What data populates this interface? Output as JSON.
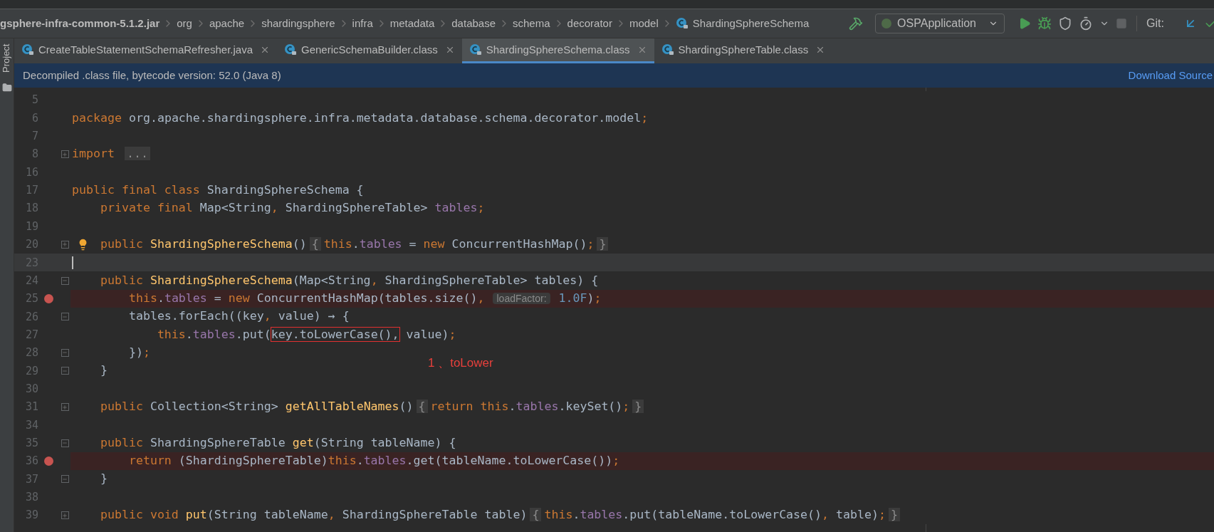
{
  "breadcrumbs": [
    {
      "label": "gsphere-infra-common-5.1.2.jar",
      "kind": "jar"
    },
    {
      "label": "org",
      "kind": "package"
    },
    {
      "label": "apache",
      "kind": "package"
    },
    {
      "label": "shardingsphere",
      "kind": "package"
    },
    {
      "label": "infra",
      "kind": "package"
    },
    {
      "label": "metadata",
      "kind": "package"
    },
    {
      "label": "database",
      "kind": "package"
    },
    {
      "label": "schema",
      "kind": "package"
    },
    {
      "label": "decorator",
      "kind": "package"
    },
    {
      "label": "model",
      "kind": "package"
    },
    {
      "label": "ShardingSphereSchema",
      "kind": "class"
    }
  ],
  "toolbar": {
    "run_config": "OSPApplication",
    "git_label": "Git:"
  },
  "side_tool": "Project",
  "tabs": [
    {
      "label": "CreateTableStatementSchemaRefresher.java",
      "selected": false
    },
    {
      "label": "GenericSchemaBuilder.class",
      "selected": false
    },
    {
      "label": "ShardingSphereSchema.class",
      "selected": true
    },
    {
      "label": "ShardingSphereTable.class",
      "selected": false
    }
  ],
  "banner": {
    "text": "Decompiled .class file, bytecode version: 52.0 (Java 8)",
    "link": "Download Source"
  },
  "lines": [
    {
      "number": "5",
      "breakpoint": false,
      "current": false
    },
    {
      "number": "6",
      "breakpoint": false,
      "current": false,
      "segments": [
        {
          "kind": "keyword",
          "text": "package "
        },
        {
          "kind": "plain",
          "text": "org.apache.shardingsphere.infra.metadata.database.schema.decorator.model"
        },
        {
          "kind": "keyword",
          "text": ";"
        }
      ]
    },
    {
      "number": "7",
      "breakpoint": false,
      "current": false
    },
    {
      "number": "8",
      "breakpoint": false,
      "current": false,
      "folded": true,
      "segments": [
        {
          "kind": "keyword",
          "text": "import "
        },
        {
          "kind": "folded",
          "text": "..."
        }
      ]
    },
    {
      "number": "16",
      "breakpoint": false,
      "current": false
    },
    {
      "number": "17",
      "breakpoint": false,
      "current": false,
      "segments": [
        {
          "kind": "keyword",
          "text": "public final class "
        },
        {
          "kind": "plain",
          "text": "ShardingSphereSchema {"
        }
      ]
    },
    {
      "number": "18",
      "breakpoint": false,
      "current": false,
      "segments": [
        {
          "kind": "keyword",
          "text": "    private final "
        },
        {
          "kind": "plain",
          "text": "Map<String"
        },
        {
          "kind": "keyword",
          "text": ", "
        },
        {
          "kind": "plain",
          "text": "ShardingSphereTable> "
        },
        {
          "kind": "field",
          "text": "tables"
        },
        {
          "kind": "keyword",
          "text": ";"
        }
      ]
    },
    {
      "number": "19",
      "breakpoint": false,
      "current": false
    },
    {
      "number": "20",
      "breakpoint": false,
      "current": false,
      "bulb": true,
      "folded": true,
      "segments": [
        {
          "kind": "keyword",
          "text": "    public "
        },
        {
          "kind": "method",
          "text": "ShardingSphereSchema"
        },
        {
          "kind": "plain",
          "text": "()"
        },
        {
          "kind": "folded",
          "text": "{"
        },
        {
          "kind": "keyword",
          "text": "this"
        },
        {
          "kind": "plain",
          "text": "."
        },
        {
          "kind": "field",
          "text": "tables"
        },
        {
          "kind": "plain",
          "text": " = "
        },
        {
          "kind": "keyword",
          "text": "new "
        },
        {
          "kind": "plain",
          "text": "ConcurrentHashMap()"
        },
        {
          "kind": "keyword",
          "text": ";"
        },
        {
          "kind": "folded",
          "text": "}"
        }
      ]
    },
    {
      "number": "23",
      "breakpoint": false,
      "current": true
    },
    {
      "number": "24",
      "breakpoint": false,
      "current": false,
      "folded": false,
      "segments": [
        {
          "kind": "keyword",
          "text": "    public "
        },
        {
          "kind": "method",
          "text": "ShardingSphereSchema"
        },
        {
          "kind": "plain",
          "text": "(Map<String"
        },
        {
          "kind": "keyword",
          "text": ", "
        },
        {
          "kind": "plain",
          "text": "ShardingSphereTable> tables) {"
        }
      ]
    },
    {
      "number": "25",
      "breakpoint": true,
      "current": false,
      "segments": [
        {
          "kind": "keyword",
          "text": "        this"
        },
        {
          "kind": "plain",
          "text": "."
        },
        {
          "kind": "field",
          "text": "tables"
        },
        {
          "kind": "plain",
          "text": " = "
        },
        {
          "kind": "keyword",
          "text": "new "
        },
        {
          "kind": "plain",
          "text": "ConcurrentHashMap(tables.size()"
        },
        {
          "kind": "keyword",
          "text": ", "
        },
        {
          "kind": "hint",
          "text": "loadFactor:"
        },
        {
          "kind": "number",
          "text": " 1.0F"
        },
        {
          "kind": "plain",
          "text": ")"
        },
        {
          "kind": "keyword",
          "text": ";"
        }
      ]
    },
    {
      "number": "26",
      "breakpoint": false,
      "current": false,
      "folded": false,
      "segments": [
        {
          "kind": "plain",
          "text": "        tables.forEach((key"
        },
        {
          "kind": "keyword",
          "text": ", "
        },
        {
          "kind": "plain",
          "text": "value) → {"
        }
      ]
    },
    {
      "number": "27",
      "breakpoint": false,
      "current": false,
      "segments": [
        {
          "kind": "keyword",
          "text": "            this"
        },
        {
          "kind": "plain",
          "text": "."
        },
        {
          "kind": "field",
          "text": "tables"
        },
        {
          "kind": "plain",
          "text": ".put("
        },
        {
          "kind": "boxed",
          "text": "key.toLowerCase(),"
        },
        {
          "kind": "plain",
          "text": " value)"
        },
        {
          "kind": "keyword",
          "text": ";"
        }
      ]
    },
    {
      "number": "28",
      "breakpoint": false,
      "current": false,
      "folded": false,
      "segments": [
        {
          "kind": "plain",
          "text": "        })"
        },
        {
          "kind": "keyword",
          "text": ";"
        }
      ]
    },
    {
      "number": "29",
      "breakpoint": false,
      "current": false,
      "folded": false,
      "segments": [
        {
          "kind": "plain",
          "text": "    }"
        }
      ]
    },
    {
      "number": "30",
      "breakpoint": false,
      "current": false
    },
    {
      "number": "31",
      "breakpoint": false,
      "current": false,
      "folded": true,
      "segments": [
        {
          "kind": "keyword",
          "text": "    public "
        },
        {
          "kind": "plain",
          "text": "Collection<String> "
        },
        {
          "kind": "method",
          "text": "getAllTableNames"
        },
        {
          "kind": "plain",
          "text": "()"
        },
        {
          "kind": "folded",
          "text": "{"
        },
        {
          "kind": "keyword",
          "text": "return this"
        },
        {
          "kind": "plain",
          "text": "."
        },
        {
          "kind": "field",
          "text": "tables"
        },
        {
          "kind": "plain",
          "text": ".keySet()"
        },
        {
          "kind": "keyword",
          "text": ";"
        },
        {
          "kind": "folded",
          "text": "}"
        }
      ]
    },
    {
      "number": "34",
      "breakpoint": false,
      "current": false
    },
    {
      "number": "35",
      "breakpoint": false,
      "current": false,
      "folded": false,
      "segments": [
        {
          "kind": "keyword",
          "text": "    public "
        },
        {
          "kind": "plain",
          "text": "ShardingSphereTable "
        },
        {
          "kind": "method",
          "text": "get"
        },
        {
          "kind": "plain",
          "text": "(String tableName) {"
        }
      ]
    },
    {
      "number": "36",
      "breakpoint": true,
      "current": false,
      "segments": [
        {
          "kind": "keyword",
          "text": "        return "
        },
        {
          "kind": "plain",
          "text": "(ShardingSphereTable)"
        },
        {
          "kind": "keyword",
          "text": "this"
        },
        {
          "kind": "plain",
          "text": "."
        },
        {
          "kind": "field",
          "text": "tables"
        },
        {
          "kind": "plain",
          "text": ".get(tableName.toLowerCase())"
        },
        {
          "kind": "keyword",
          "text": ";"
        }
      ]
    },
    {
      "number": "37",
      "breakpoint": false,
      "current": false,
      "folded": false,
      "segments": [
        {
          "kind": "plain",
          "text": "    }"
        }
      ]
    },
    {
      "number": "38",
      "breakpoint": false,
      "current": false
    },
    {
      "number": "39",
      "breakpoint": false,
      "current": false,
      "folded": true,
      "segments": [
        {
          "kind": "keyword",
          "text": "    public void "
        },
        {
          "kind": "method",
          "text": "put"
        },
        {
          "kind": "plain",
          "text": "(String tableName"
        },
        {
          "kind": "keyword",
          "text": ", "
        },
        {
          "kind": "plain",
          "text": "ShardingSphereTable table)"
        },
        {
          "kind": "folded",
          "text": "{"
        },
        {
          "kind": "keyword",
          "text": "this"
        },
        {
          "kind": "plain",
          "text": "."
        },
        {
          "kind": "field",
          "text": "tables"
        },
        {
          "kind": "plain",
          "text": ".put(tableName.toLowerCase()"
        },
        {
          "kind": "keyword",
          "text": ", "
        },
        {
          "kind": "plain",
          "text": "table)"
        },
        {
          "kind": "keyword",
          "text": ";"
        },
        {
          "kind": "folded",
          "text": "}"
        }
      ]
    }
  ],
  "annotation": "1 、toLower"
}
